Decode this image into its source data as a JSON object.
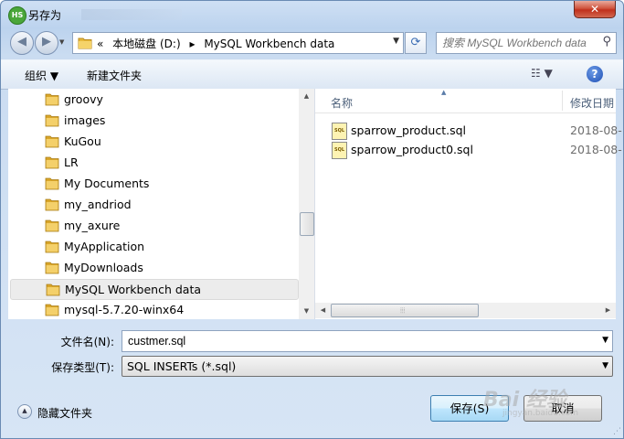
{
  "window": {
    "title": "另存为",
    "app_icon_text": "HS",
    "close_label": "✕"
  },
  "nav": {
    "back": "◀",
    "forward": "▶",
    "history_dropdown": "▼",
    "address_prefix": "«",
    "crumbs": [
      "本地磁盘 (D:)",
      "▸",
      "MySQL Workbench data"
    ],
    "address_dropdown": "▼",
    "refresh": "⟳",
    "search_placeholder": "搜索 MySQL Workbench data",
    "search_icon": "⚲"
  },
  "toolbar": {
    "organize": "组织 ▼",
    "new_folder": "新建文件夹",
    "view": "☷ ▼",
    "help": "?"
  },
  "folders": [
    {
      "label": "groovy"
    },
    {
      "label": "images"
    },
    {
      "label": "KuGou"
    },
    {
      "label": "LR"
    },
    {
      "label": "My Documents"
    },
    {
      "label": "my_andriod"
    },
    {
      "label": "my_axure"
    },
    {
      "label": "MyApplication"
    },
    {
      "label": "MyDownloads"
    },
    {
      "label": "MySQL Workbench data",
      "selected": true
    },
    {
      "label": "mysql-5.7.20-winx64"
    }
  ],
  "columns": {
    "name": "名称",
    "modified": "修改日期"
  },
  "files": [
    {
      "name": "sparrow_product.sql",
      "date": "2018-08-",
      "icon": "SQL"
    },
    {
      "name": "sparrow_product0.sql",
      "date": "2018-08-",
      "icon": "SQL"
    }
  ],
  "form": {
    "filename_label": "文件名(N):",
    "filename_value": "custmer.sql",
    "filetype_label": "保存类型(T):",
    "filetype_value": "SQL INSERTs (*.sql)",
    "dropdown": "▼"
  },
  "footer": {
    "hide_folders": "隐藏文件夹",
    "hide_icon": "▲",
    "save": "保存(S)",
    "cancel": "取消"
  },
  "watermark": {
    "brand": "Bai 经验",
    "url": "jingyan.baidu.com"
  },
  "colors": {
    "selection": "#ececec",
    "window_frame": "#bcd3ee",
    "close_red": "#c0301c"
  }
}
